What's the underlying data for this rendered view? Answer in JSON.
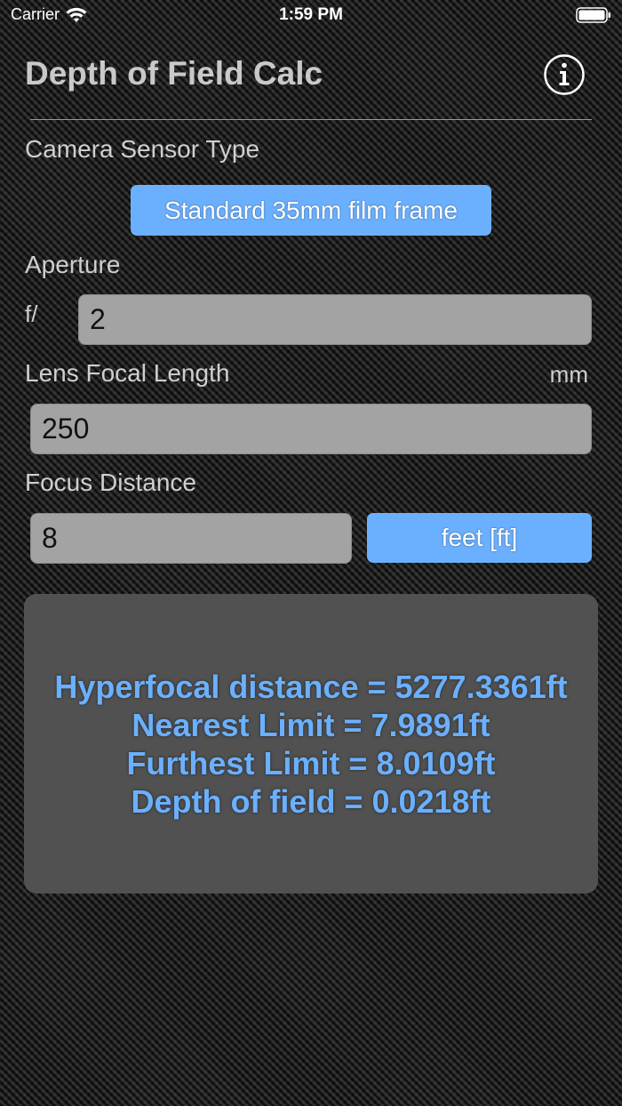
{
  "status_bar": {
    "carrier": "Carrier",
    "time": "1:59 PM",
    "wifi_icon": "wifi-icon",
    "battery_icon": "battery-icon"
  },
  "header": {
    "title": "Depth of Field Calc",
    "info_icon": "info-icon"
  },
  "sensor": {
    "label": "Camera Sensor Type",
    "button_label": "Standard 35mm film frame"
  },
  "aperture": {
    "label": "Aperture",
    "prefix": "f/",
    "value": "2"
  },
  "focal_length": {
    "label": "Lens Focal Length",
    "unit": "mm",
    "value": "250"
  },
  "focus_distance": {
    "label": "Focus Distance",
    "value": "8",
    "unit_button_label": "feet [ft]"
  },
  "results": {
    "lines": [
      "Hyperfocal distance = 5277.3361ft",
      "Nearest Limit = 7.9891ft",
      "Furthest Limit = 8.0109ft",
      "Depth of field = 0.0218ft"
    ]
  },
  "colors": {
    "accent_blue": "#6bb0ff",
    "field_gray": "#a3a3a3",
    "panel_gray": "#515151"
  }
}
